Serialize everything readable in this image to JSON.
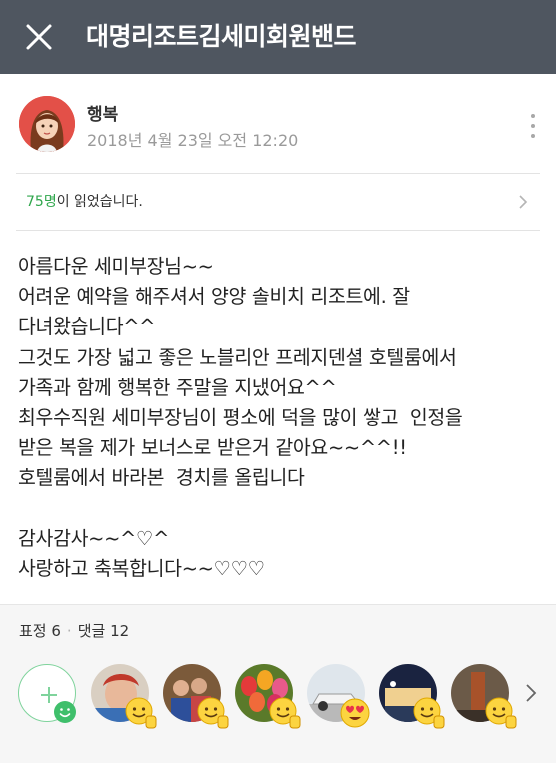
{
  "header": {
    "title": "대명리조트김세미회원밴드"
  },
  "post": {
    "author": "행복",
    "time": "2018년 4월 23일 오전 12:20",
    "read_count": "75명",
    "read_suffix": "이 읽었습니다.",
    "body": "아름다운 세미부장님~~\n어려운 예약을 해주셔서 양양 솔비치 리조트에. 잘\n다녀왔습니다^^\n그것도 가장 넓고 좋은 노블리안 프레지덴셜 호텔룸에서\n가족과 함께 행복한 주말을 지냈어요^^\n최우수직원 세미부장님이 평소에 덕을 많이 쌓고  인정을\n받은 복을 제가 보너스로 받은거 같아요~~^^!!\n호텔룸에서 바라본  경치를 올립니다\n\n감사감사~~^♡^\n사랑하고 축복합니다~~♡♡♡"
  },
  "stats": {
    "reactions_label": "표정 6",
    "comments_label": "댓글 12"
  },
  "reactions": [
    {
      "emoji": "thumbs-up-smile"
    },
    {
      "emoji": "thumbs-up-smile"
    },
    {
      "emoji": "thumbs-up-smile"
    },
    {
      "emoji": "heart-eyes"
    },
    {
      "emoji": "thumbs-up-smile"
    },
    {
      "emoji": "thumbs-up-smile"
    }
  ],
  "colors": {
    "header_bg": "#4f5660",
    "accent_green": "#2fa64c"
  }
}
